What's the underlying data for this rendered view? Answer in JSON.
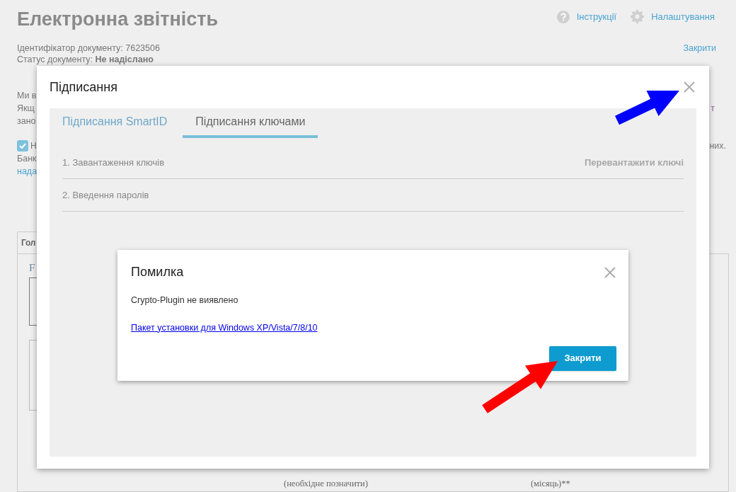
{
  "page": {
    "title": "Електронна звітність",
    "header_links": [
      {
        "kind": "help",
        "label": "Інструкції"
      },
      {
        "kind": "settings",
        "label": "Налаштування"
      }
    ],
    "close_link": "Закрити",
    "document_id": "Ідентифікатор документу: 7623506",
    "document_status": "Статус документу: **Не надіслано**",
    "notice_lines": [
      {
        "left": "Ми в"
      },
      {
        "left": "Якщ",
        "right": "т"
      },
      {
        "left": "зано"
      }
    ],
    "consent": {
      "checked": true,
      "left": "Н",
      "right": "них.",
      "lines": [
        {
          "text": "Банк",
          "kind": "text"
        },
        {
          "text": "нада",
          "kind": "link"
        }
      ]
    },
    "form_tab": "Гол",
    "form_letter": "F",
    "form_captions": [
      "(необхідне позначити)",
      "(місяць)**"
    ]
  },
  "signing_dialog": {
    "title": "Підписання",
    "tabs": [
      {
        "label": "Підписання SmartID",
        "selected": false
      },
      {
        "label": "Підписання ключами",
        "selected": true
      }
    ],
    "steps": [
      {
        "label": "1. Завантаження ключів",
        "action": {
          "label": "Перевантажити ключі",
          "disabled": true
        }
      },
      {
        "label": "2. Введення паролів"
      }
    ]
  },
  "error_dialog": {
    "title": "Помилка",
    "message": "Crypto-Plugin не виявлено",
    "link": "Пакет установки для Windows XP/Vista/7/8/10",
    "button": "Закрити"
  },
  "annotations": [
    {
      "kind": "arrow",
      "color": "#0000ff"
    },
    {
      "kind": "arrow",
      "color": "#ff0000"
    }
  ]
}
